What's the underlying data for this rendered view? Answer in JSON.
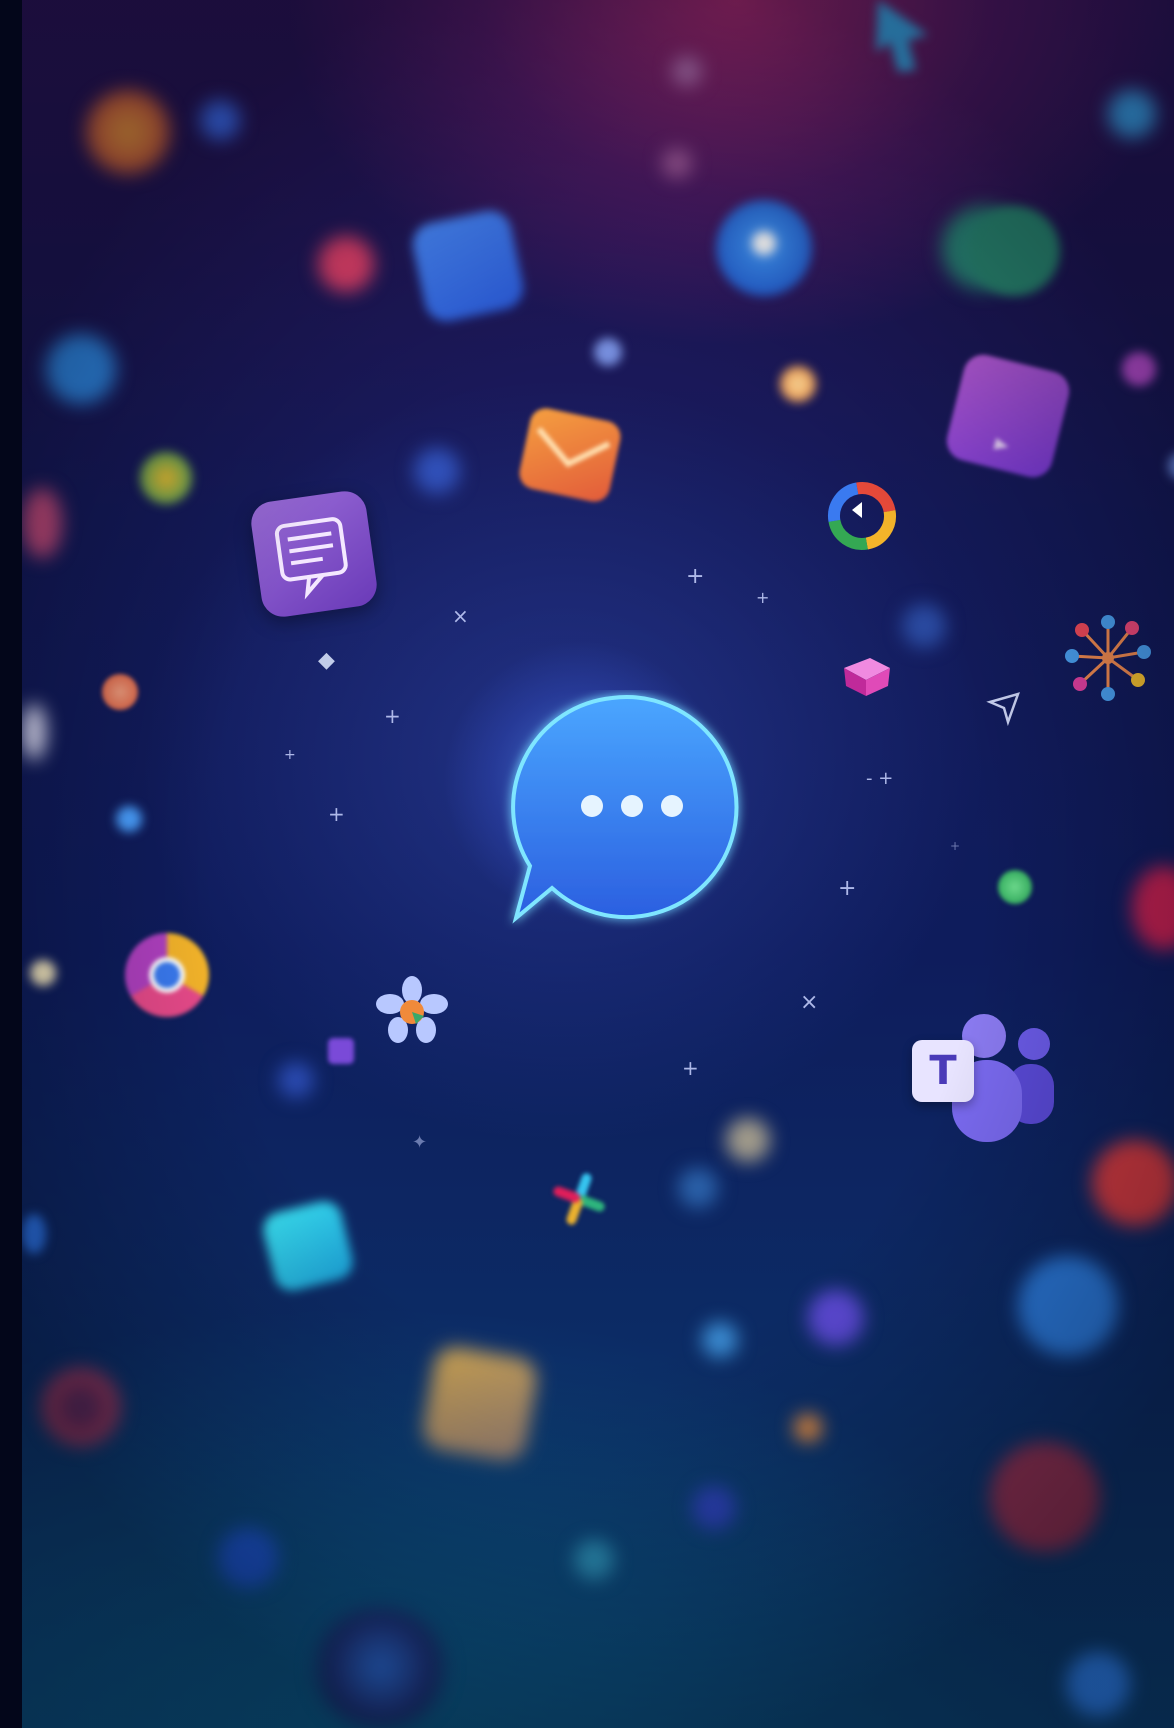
{
  "scene": {
    "subject": "chat-bubble-with-typing-dots",
    "teams_badge_letter": "T",
    "colors": {
      "bubble_top": "#4aa6ff",
      "bubble_bottom": "#2b5fe0",
      "glow": "#7fe6ff",
      "teams_purple": "#6b5be8",
      "background_top": "#a82a70",
      "background_bottom": "#0b3f6e"
    },
    "icons": [
      "chat-bubble-icon",
      "teams-icon",
      "chrome-icon",
      "notes-chat-icon",
      "mail-icon",
      "video-play-icon",
      "sync-ring-icon",
      "network-nodes-icon",
      "cube-icon",
      "pinwheel-icon"
    ]
  }
}
